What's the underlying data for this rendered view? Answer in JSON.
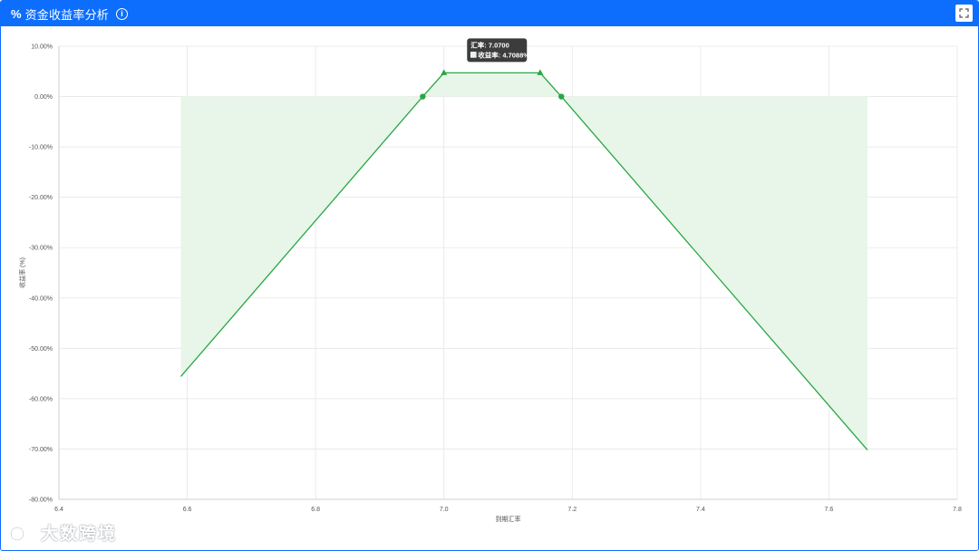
{
  "header": {
    "icon": "percent-icon",
    "title": "资金收益率分析",
    "info_icon": "info-circle-icon",
    "expand_icon": "expand-icon",
    "background_color": "#0d6efd"
  },
  "chart_data": {
    "type": "area",
    "xlabel": "到期汇率",
    "ylabel": "收益率 (%)",
    "xlim": [
      6.4,
      7.8
    ],
    "ylim": [
      -80,
      10
    ],
    "x_ticks": [
      "6.4",
      "6.6",
      "6.8",
      "7.0",
      "7.2",
      "7.4",
      "7.6",
      "7.8"
    ],
    "y_ticks": [
      "10.00%",
      "0.00%",
      "-10.00%",
      "-20.00%",
      "-30.00%",
      "-40.00%",
      "-50.00%",
      "-60.00%",
      "-70.00%",
      "-80.00%"
    ],
    "grid": true,
    "series": [
      {
        "color": "#28a745",
        "fill_color": "#e8f5e9",
        "points": [
          {
            "x": 6.59,
            "y": -55.6
          },
          {
            "x": 6.967,
            "y": 0.0
          },
          {
            "x": 7.0,
            "y": 4.7088
          },
          {
            "x": 7.07,
            "y": 4.7088
          },
          {
            "x": 7.15,
            "y": 4.7088
          },
          {
            "x": 7.183,
            "y": 0.0
          },
          {
            "x": 7.66,
            "y": -70.2
          }
        ]
      }
    ],
    "markers": [
      {
        "x": 6.967,
        "y": 0.0,
        "shape": "circle"
      },
      {
        "x": 7.0,
        "y": 4.7088,
        "shape": "triangle"
      },
      {
        "x": 7.15,
        "y": 4.7088,
        "shape": "triangle"
      },
      {
        "x": 7.183,
        "y": 0.0,
        "shape": "circle"
      }
    ],
    "tooltip": {
      "title": "汇率: 7.0700",
      "label": "收益率: 4.7088%",
      "x": 7.07,
      "y": 4.7088
    }
  },
  "watermark": "大数跨境"
}
